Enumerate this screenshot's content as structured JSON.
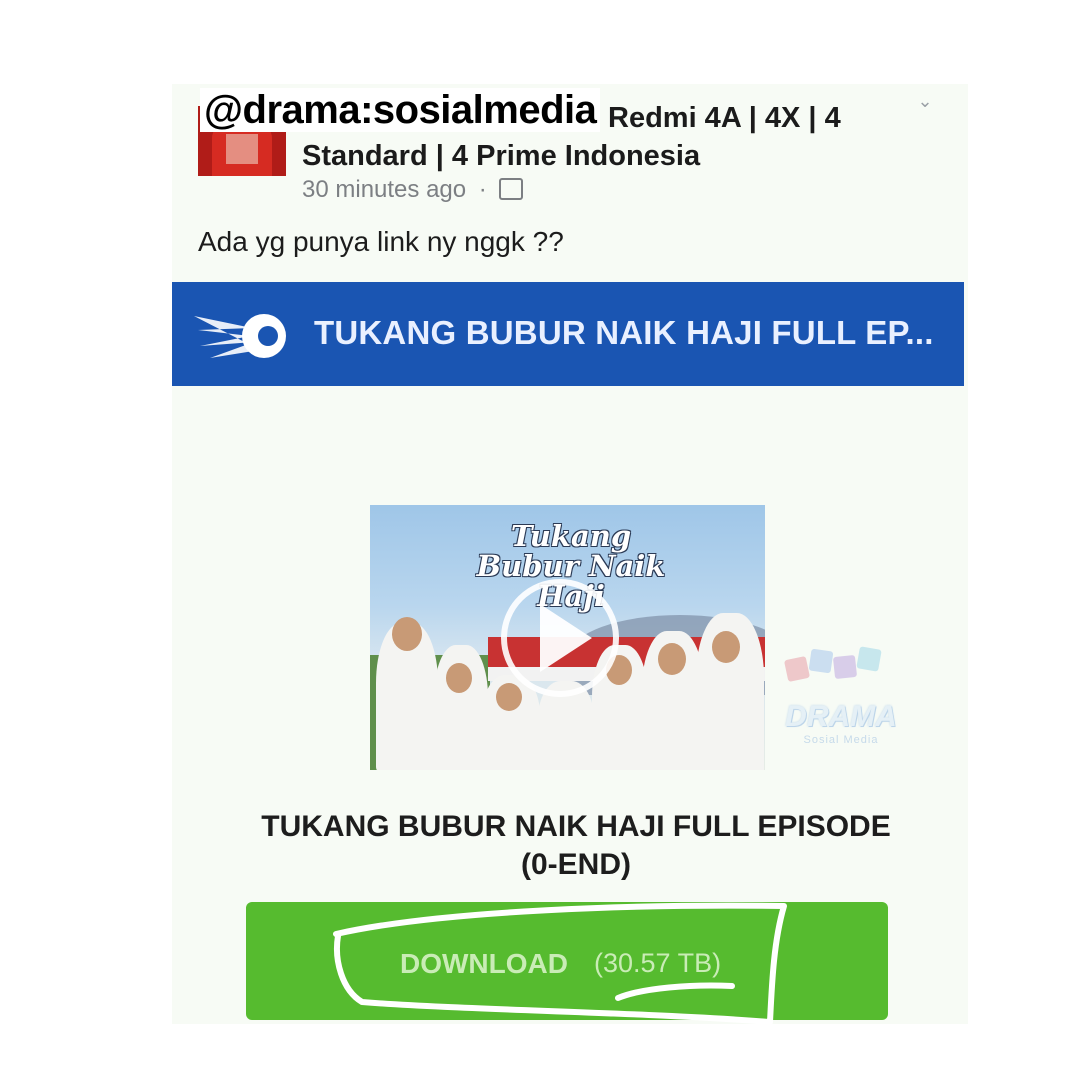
{
  "watermark": "@drama:sosialmedia",
  "post": {
    "group_name_line1": "Redmi 4A | 4X | 4",
    "group_name_line2": "Standard | 4 Prime Indonesia",
    "time": "30 minutes ago",
    "separator": "·",
    "audience_icon": "group-icon",
    "text": "Ada yg punya link ny nggk ??"
  },
  "link_preview": {
    "banner_title": "TUKANG BUBUR NAIK HAJI FULL EP...",
    "banner_color": "#1a55b2",
    "thumbnail_title": "Tukang Bubur Naik Haji",
    "title_line1": "TUKANG BUBUR NAIK HAJI FULL EPISODE",
    "title_line2": "(0-END)",
    "download_label": "DOWNLOAD",
    "download_size": "(30.57 TB)",
    "download_color": "#56bb2f"
  },
  "logo_watermark": {
    "word": "DRAMA",
    "sub": "Sosial Media"
  }
}
